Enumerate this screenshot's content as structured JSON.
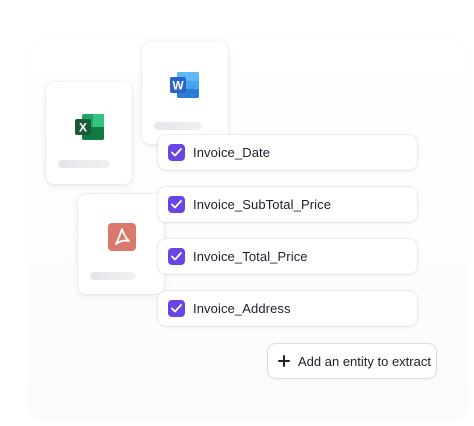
{
  "colors": {
    "accent": "#6a45e6",
    "excel": "#1f7a45",
    "word": "#2b63c8",
    "pdf": "#d9796c"
  },
  "files": [
    {
      "type": "excel",
      "icon": "excel-icon",
      "letter": "X"
    },
    {
      "type": "word",
      "icon": "word-icon",
      "letter": "W"
    },
    {
      "type": "pdf",
      "icon": "pdf-icon"
    }
  ],
  "entities": [
    {
      "label": "Invoice_Date",
      "checked": true
    },
    {
      "label": "Invoice_SubTotal_Price",
      "checked": true
    },
    {
      "label": "Invoice_Total_Price",
      "checked": true
    },
    {
      "label": "Invoice_Address",
      "checked": true
    }
  ],
  "add_button": {
    "label": "Add an entity to extract",
    "icon": "plus-icon"
  }
}
